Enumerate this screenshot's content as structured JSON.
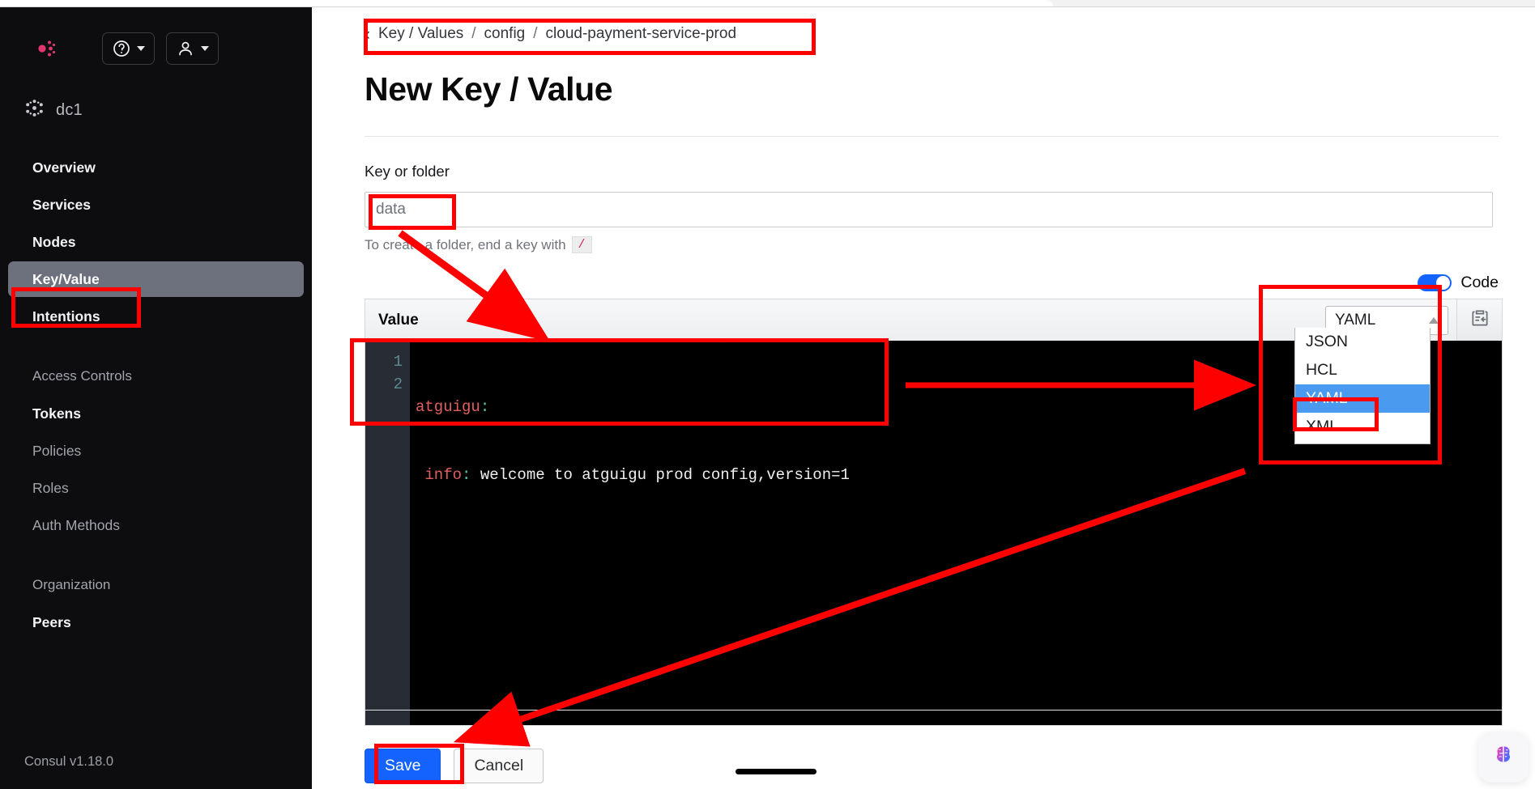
{
  "browser": {
    "tab_strip": ""
  },
  "sidebar": {
    "logo_name": "consul-logo",
    "help_icon": "question-circle-icon",
    "user_icon": "user-icon",
    "datacenter": {
      "icon": "datacenter-snowflake-icon",
      "label": "dc1"
    },
    "items": [
      {
        "label": "Overview",
        "style": "bold",
        "active": false
      },
      {
        "label": "Services",
        "style": "bold",
        "active": false
      },
      {
        "label": "Nodes",
        "style": "bold",
        "active": false
      },
      {
        "label": "Key/Value",
        "style": "bold",
        "active": true
      },
      {
        "label": "Intentions",
        "style": "bold",
        "active": false
      },
      {
        "label": "Access Controls",
        "style": "section",
        "active": false
      },
      {
        "label": "Tokens",
        "style": "bold",
        "active": false
      },
      {
        "label": "Policies",
        "style": "muted",
        "active": false
      },
      {
        "label": "Roles",
        "style": "muted",
        "active": false
      },
      {
        "label": "Auth Methods",
        "style": "muted",
        "active": false
      },
      {
        "label": "Organization",
        "style": "section",
        "active": false
      },
      {
        "label": "Peers",
        "style": "bold",
        "active": false
      }
    ],
    "version": "Consul v1.18.0"
  },
  "breadcrumb": {
    "back_icon": "chevron-left-icon",
    "items": [
      "Key / Values",
      "config",
      "cloud-payment-service-prod"
    ],
    "separator": "/"
  },
  "page": {
    "title": "New Key / Value"
  },
  "key_field": {
    "label": "Key or folder",
    "value": "data",
    "placeholder": "data",
    "hint_prefix": "To create a folder, end a key with",
    "hint_code": "/"
  },
  "code_toggle": {
    "label": "Code",
    "enabled": true
  },
  "value_panel": {
    "title": "Value",
    "paste_icon": "clipboard-paste-icon",
    "syntax_select": {
      "selected": "YAML",
      "caret_icon": "caret-up-icon",
      "options": [
        "JSON",
        "HCL",
        "YAML",
        "XML"
      ],
      "highlighted": "YAML",
      "open": true
    },
    "editor": {
      "language": "yaml",
      "lines": [
        {
          "number": "1",
          "tokens": [
            {
              "text": "atguigu",
              "type": "key"
            },
            {
              "text": ":",
              "type": "colon"
            }
          ]
        },
        {
          "number": "2",
          "tokens": [
            {
              "text": " ",
              "type": "plain"
            },
            {
              "text": "info",
              "type": "key"
            },
            {
              "text": ":",
              "type": "colon"
            },
            {
              "text": " welcome to atguigu prod config,version=1",
              "type": "plain"
            }
          ]
        }
      ],
      "raw": "atguigu:\n info: welcome to atguigu prod config,version=1"
    }
  },
  "actions": {
    "save_label": "Save",
    "cancel_label": "Cancel"
  },
  "widgets": {
    "ai_assistant_icon": "brain-icon",
    "home_indicator": ""
  },
  "annotations": {
    "color": "#FF0000",
    "boxes": [
      {
        "name": "sidebar-keyvalue-highlight"
      },
      {
        "name": "breadcrumb-highlight"
      },
      {
        "name": "key-input-highlight"
      },
      {
        "name": "editor-content-highlight"
      },
      {
        "name": "syntax-dropdown-highlight"
      },
      {
        "name": "yaml-option-highlight"
      },
      {
        "name": "save-button-highlight"
      }
    ],
    "arrows": [
      {
        "name": "arrow-key-to-editor"
      },
      {
        "name": "arrow-editor-to-dropdown"
      },
      {
        "name": "arrow-dropdown-to-save"
      }
    ]
  }
}
